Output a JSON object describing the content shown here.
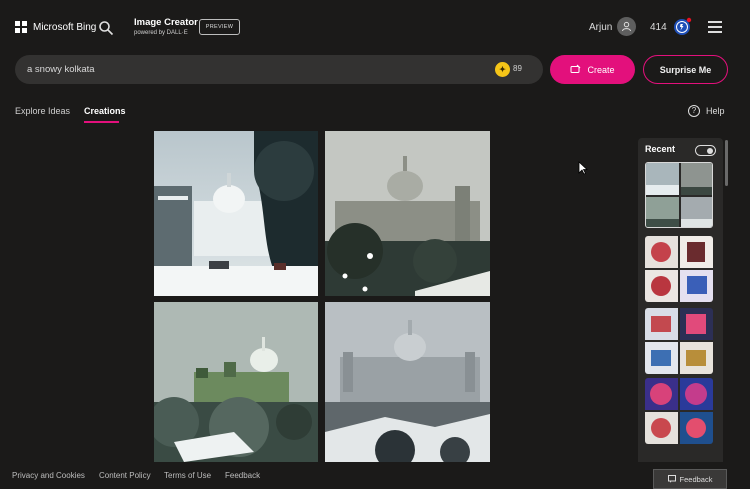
{
  "header": {
    "brand": "Microsoft Bing",
    "product_title": "Image Creator",
    "product_subtitle": "powered by DALL·E",
    "preview_badge": "PREVIEW",
    "user_name": "Arjun",
    "points": "414"
  },
  "prompt": {
    "value": "a snowy kolkata",
    "boosts": "89"
  },
  "buttons": {
    "create": "Create",
    "surprise": "Surprise Me"
  },
  "tabs": {
    "explore": "Explore Ideas",
    "creations": "Creations"
  },
  "help": "Help",
  "recent": {
    "label": "Recent"
  },
  "footer": {
    "links": [
      "Privacy and Cookies",
      "Content Policy",
      "Terms of Use",
      "Feedback"
    ],
    "feedback_button": "Feedback"
  },
  "icons": [
    "windows-logo-icon",
    "search-icon",
    "user-avatar-icon",
    "rewards-medal-icon",
    "hamburger-menu-icon",
    "boost-coin-icon",
    "create-wand-icon",
    "help-icon",
    "feedback-icon"
  ],
  "colors": {
    "accent": "#e3107c",
    "background": "#1b1a19",
    "prompt_bar": "#333231",
    "boost": "#f5c518"
  }
}
